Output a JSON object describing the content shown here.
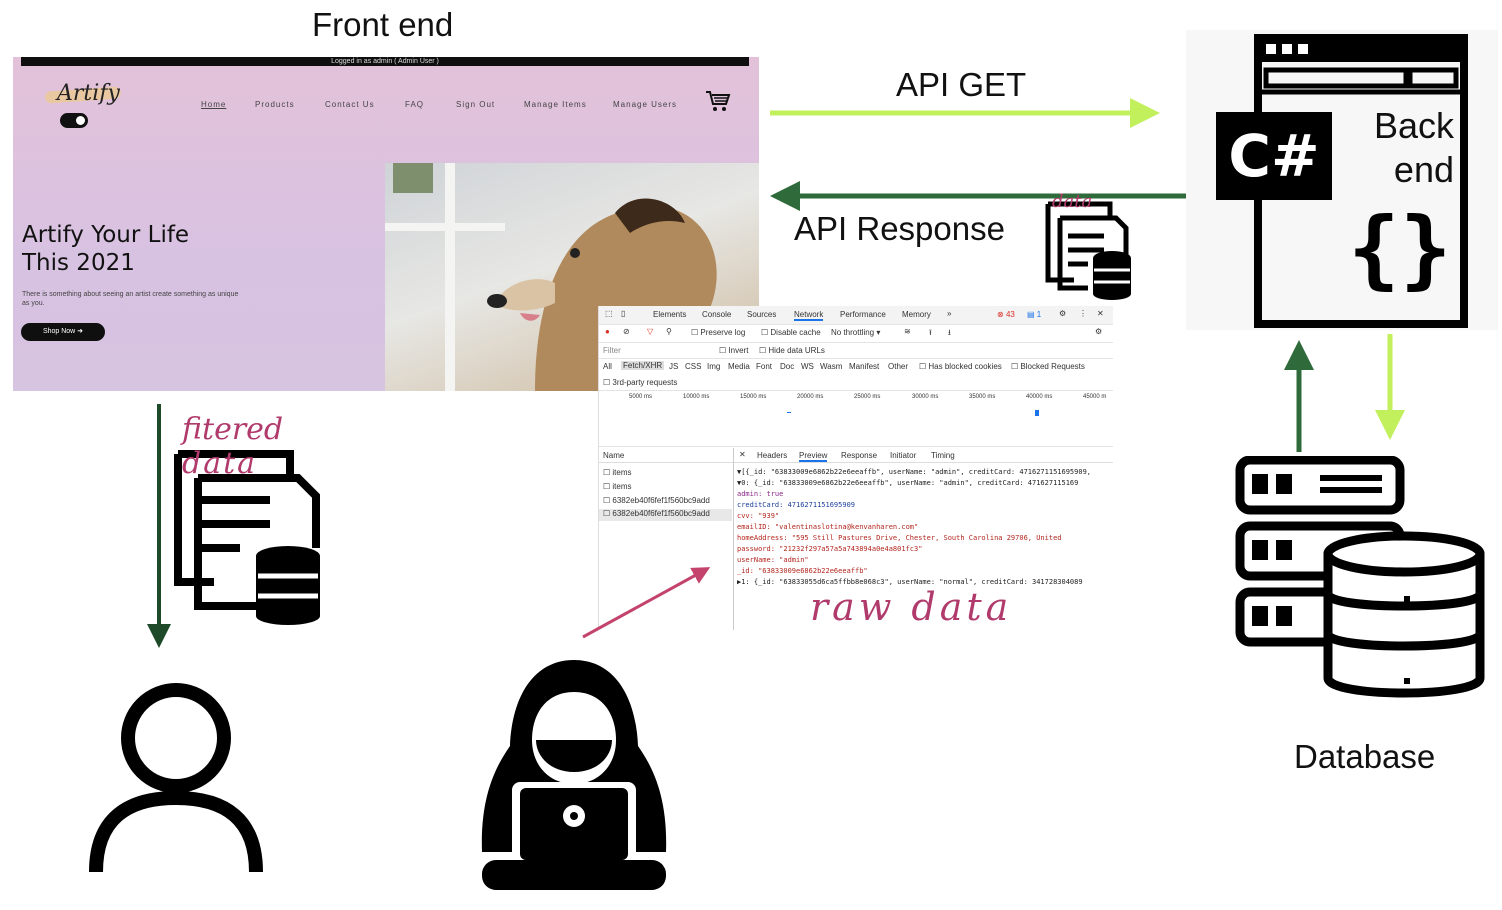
{
  "labels": {
    "front_end": "Front end",
    "api_get": "API GET",
    "api_response": "API Response",
    "back_end_line1": "Back",
    "back_end_line2": "end",
    "csharp": "C#",
    "database": "Database",
    "filtered": "fitered",
    "filtered_data": "data",
    "response_data": "data",
    "raw_data": "raw data"
  },
  "website": {
    "topbar": "Logged in as admin ( Admin User )",
    "logo": "Artify",
    "nav": [
      "Home",
      "Products",
      "Contact Us",
      "FAQ",
      "Sign Out",
      "Manage Items",
      "Manage Users"
    ],
    "hero_title_line1": "Artify Your Life",
    "hero_title_line2": "This 2021",
    "hero_sub": "There is something about seeing an artist create something as unique as you.",
    "shop_button": "Shop Now"
  },
  "devtools": {
    "tabs": [
      "Elements",
      "Console",
      "Sources",
      "Network",
      "Performance",
      "Memory",
      "»"
    ],
    "error_count": "43",
    "msg_count": "1",
    "toolbar": {
      "preserve_log": "Preserve log",
      "disable_cache": "Disable cache",
      "throttle": "No throttling"
    },
    "filter_placeholder": "Filter",
    "invert": "Invert",
    "hide_data_urls": "Hide data URLs",
    "types": [
      "All",
      "Fetch/XHR",
      "JS",
      "CSS",
      "Img",
      "Media",
      "Font",
      "Doc",
      "WS",
      "Wasm",
      "Manifest",
      "Other"
    ],
    "blocked_cookies": "Has blocked cookies",
    "blocked_requests": "Blocked Requests",
    "third_party": "3rd-party requests",
    "timeline": [
      "5000 ms",
      "10000 ms",
      "15000 ms",
      "20000 ms",
      "25000 ms",
      "30000 ms",
      "35000 ms",
      "40000 ms",
      "45000 m"
    ],
    "name_header": "Name",
    "requests": [
      "items",
      "items",
      "6382eb40f6fef1f560bc9add",
      "6382eb40f6fef1f560bc9add"
    ],
    "detail_tabs": [
      "Headers",
      "Preview",
      "Response",
      "Initiator",
      "Timing"
    ],
    "preview_lines": [
      "▼[{_id: \"63833009e6862b22e6eeaffb\", userName: \"admin\", creditCard: 4716271151695909,",
      "  ▼0: {_id: \"63833009e6862b22e6eeaffb\", userName: \"admin\", creditCard: 471627115169",
      "      admin: true",
      "      creditCard: 4716271151695909",
      "      cvv: \"939\"",
      "      emailID: \"valentinaslotina@kenvanharen.com\"",
      "      homeAddress: \"595 Still Pastures Drive, Chester, South Carolina 29706, United",
      "      password: \"21232f297a57a5a743894a0e4a801fc3\"",
      "      userName: \"admin\"",
      "      _id: \"63833009e6862b22e6eeaffb\"",
      "  ▶1: {_id: \"63833055d6ca5ffbb8e068c3\", userName: \"normal\", creditCard: 341728304089"
    ]
  },
  "colors": {
    "light_green": "#c1f05c",
    "dark_green": "#2f6a3a",
    "arrow_pink": "#c4436c",
    "handwriting": "#b03a6b"
  }
}
